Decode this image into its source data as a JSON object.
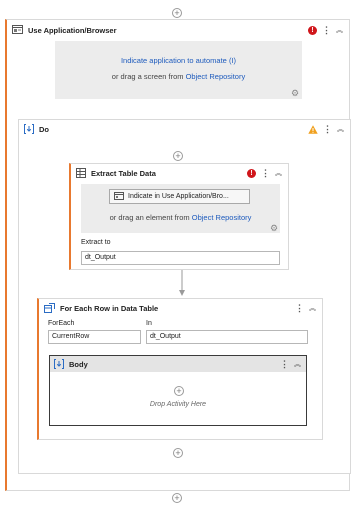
{
  "use_app": {
    "title": "Use Application/Browser",
    "indicate_link": "Indicate application to automate (I)",
    "drag_text": "or drag a screen from",
    "object_repository": "Object Repository"
  },
  "do": {
    "title": "Do"
  },
  "extract": {
    "title": "Extract Table Data",
    "indicate_button": "Indicate in Use Application/Bro...",
    "drag_text": "or drag an element from",
    "object_repository": "Object Repository",
    "extract_to_label": "Extract to",
    "extract_to_value": "dt_Output"
  },
  "foreach": {
    "title": "For Each Row in Data Table",
    "foreach_label": "ForEach",
    "foreach_value": "CurrentRow",
    "in_label": "In",
    "in_value": "dt_Output"
  },
  "body": {
    "title": "Body",
    "drop_text": "Drop Activity Here"
  },
  "colors": {
    "accent_orange": "#e8792f",
    "error_red": "#d0161b",
    "warning_orange": "#f0a01e",
    "link_blue": "#1e5bbd"
  }
}
